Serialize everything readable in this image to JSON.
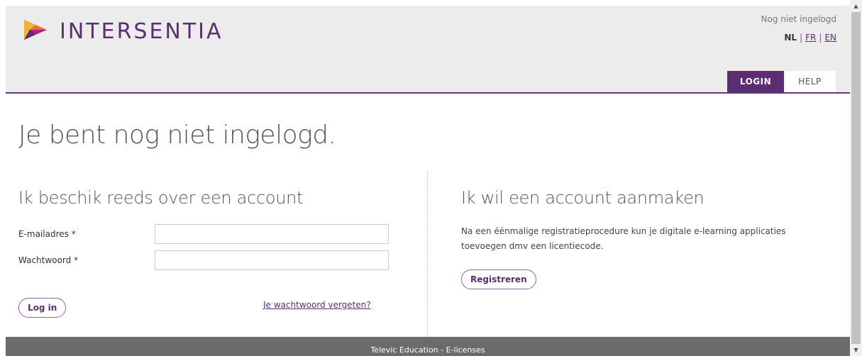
{
  "header": {
    "brand_name": "INTERSENTIA",
    "login_status": "Nog niet ingelogd",
    "languages": {
      "active": "NL",
      "options": [
        "FR",
        "EN"
      ],
      "separator": "|"
    },
    "nav": {
      "login": "LOGIN",
      "help": "HELP"
    }
  },
  "main": {
    "title": "Je bent nog niet ingelogd.",
    "login_section": {
      "heading": "Ik beschik reeds over een account",
      "email_label": "E-mailadres *",
      "email_value": "",
      "password_label": "Wachtwoord *",
      "password_value": "",
      "login_button": "Log in",
      "forgot_link": "Je wachtwoord vergeten?"
    },
    "register_section": {
      "heading": "Ik wil een account aanmaken",
      "description": "Na een éénmalige registratieprocedure kun je digitale e-learning applicaties toevoegen dmv een licentiecode.",
      "register_button": "Registreren"
    }
  },
  "footer": {
    "text": "Televic Education - E-licenses"
  },
  "colors": {
    "accent": "#5b2e74",
    "header_bg": "#ececec",
    "footer_bg": "#6b6b6b"
  }
}
